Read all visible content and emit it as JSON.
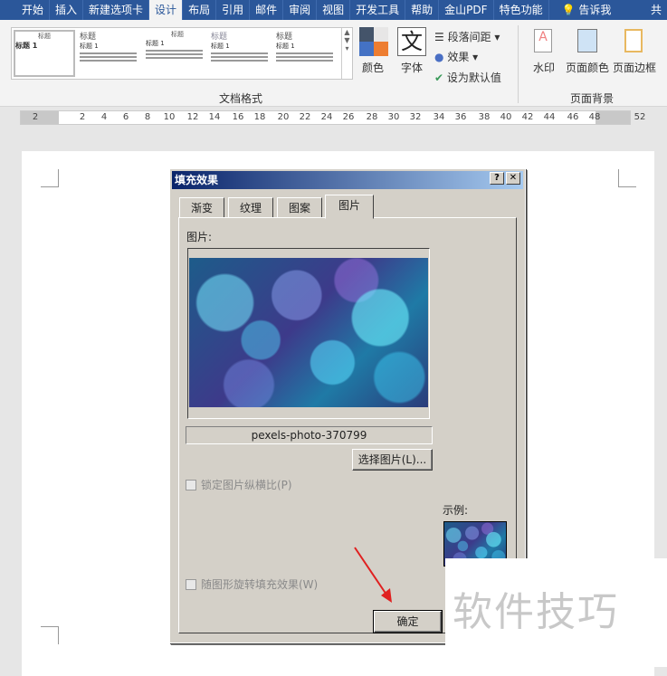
{
  "menu_tabs": [
    "开始",
    "插入",
    "新建选项卡",
    "设计",
    "布局",
    "引用",
    "邮件",
    "审阅",
    "视图",
    "开发工具",
    "帮助",
    "金山PDF",
    "特色功能",
    "告诉我",
    "共"
  ],
  "ribbon": {
    "gallery": [
      {
        "title": "标题",
        "sub": "标题 1"
      },
      {
        "title": "标题",
        "sub": "标题 1"
      },
      {
        "title": "标题",
        "sub": "标题 1"
      },
      {
        "title": "标题",
        "sub": "标题 1"
      },
      {
        "title": "标题",
        "sub": "标题 1"
      }
    ],
    "colors": "颜色",
    "fonts": "字体",
    "para_spacing": "段落间距",
    "effects": "效果",
    "set_default": "设为默认值",
    "group_doc_format": "文档格式",
    "watermark": "水印",
    "page_color": "页面颜色",
    "page_border": "页面边框",
    "group_page_bg": "页面背景"
  },
  "ruler": [
    "2",
    "2",
    "4",
    "6",
    "8",
    "10",
    "12",
    "14",
    "16",
    "18",
    "20",
    "22",
    "24",
    "26",
    "28",
    "30",
    "32",
    "34",
    "36",
    "38",
    "40",
    "42",
    "44",
    "46",
    "48",
    "52"
  ],
  "dialog": {
    "title": "填充效果",
    "help": "?",
    "close": "✕",
    "tabs": [
      "渐变",
      "纹理",
      "图案",
      "图片"
    ],
    "picture_label": "图片:",
    "file_name": "pexels-photo-370799",
    "select_button": "选择图片(L)...",
    "lock_aspect": "锁定图片纵横比(P)",
    "sample_label": "示例:",
    "rotate_with_shape": "随图形旋转填充效果(W)",
    "ok": "确定"
  },
  "watermark_text": "软件技巧"
}
